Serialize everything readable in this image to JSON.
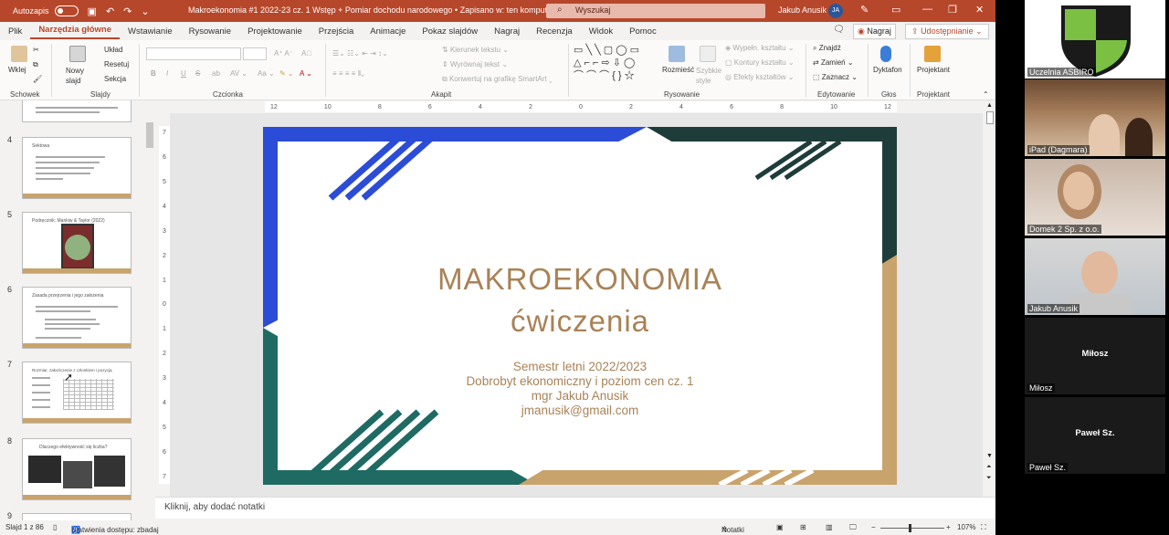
{
  "titlebar": {
    "autosave_label": "Autozapis",
    "doc_title": "Makroekonomia #1 2022-23 cz. 1 Wstęp + Pomiar dochodu narodowego • Zapisano w: ten komputer ⌄",
    "search_placeholder": "Wyszukaj",
    "user_name": "Jakub Anusik",
    "user_initials": "JA"
  },
  "tabs": [
    "Plik",
    "Narzędzia główne",
    "Wstawianie",
    "Rysowanie",
    "Projektowanie",
    "Przejścia",
    "Animacje",
    "Pokaz slajdów",
    "Nagraj",
    "Recenzja",
    "Widok",
    "Pomoc"
  ],
  "tab_actions": {
    "record": "Nagraj",
    "share": "Udostępnianie"
  },
  "ribbon": {
    "clipboard": {
      "paste": "Wklej",
      "group": "Schowek"
    },
    "slides": {
      "new_slide": "Nowy slajd",
      "layout": "Układ",
      "reset": "Resetuj",
      "section": "Sekcja",
      "group": "Slajdy"
    },
    "font": {
      "group": "Czcionka",
      "bold": "B",
      "italic": "I",
      "underline": "U",
      "strike": "S"
    },
    "paragraph": {
      "text_direction": "Kierunek tekstu",
      "align_text": "Wyrównaj tekst",
      "smartart": "Konwertuj na grafikę SmartArt",
      "group": "Akapit"
    },
    "drawing": {
      "arrange": "Rozmieść",
      "quick_styles": "Szybkie style",
      "fill": "Wypełn. kształtu",
      "outline": "Kontury kształtu",
      "effects": "Efekty kształtów",
      "group": "Rysowanie"
    },
    "editing": {
      "find": "Znajdź",
      "replace": "Zamień",
      "select": "Zaznacz",
      "group": "Edytowanie"
    },
    "voice": {
      "dictate": "Dyktafon",
      "group": "Głos"
    },
    "designer": {
      "label": "Projektant",
      "group": "Projektant"
    }
  },
  "thumbnails": [
    {
      "num": "4",
      "title": "Sektowa"
    },
    {
      "num": "5",
      "title": "Podręcznik: Mankiw & Taylor (2022)"
    },
    {
      "num": "6",
      "title": "Zasada przejrzenia i jego założenia"
    },
    {
      "num": "7",
      "title": "Rozmiar, zakończenie z członkiem i pozycją"
    },
    {
      "num": "8",
      "title": "Dlaczego efektywność się liczba?"
    },
    {
      "num": "9",
      "title": ""
    }
  ],
  "ruler_h": [
    "12",
    "10",
    "8",
    "6",
    "4",
    "2",
    "0",
    "2",
    "4",
    "6",
    "8",
    "10",
    "12"
  ],
  "ruler_v": [
    "7",
    "6",
    "5",
    "4",
    "3",
    "2",
    "1",
    "0",
    "1",
    "2",
    "3",
    "4",
    "5",
    "6",
    "7"
  ],
  "slide": {
    "title1": "MAKROEKONOMIA",
    "title2": "ćwiczenia",
    "line1": "Semestr letni 2022/2023",
    "line2": "Dobrobyt ekonomiczny i poziom cen cz. 1",
    "line3": "mgr Jakub Anusik",
    "line4": "jmanusik@gmail.com"
  },
  "notes_placeholder": "Kliknij, aby dodać notatki",
  "status": {
    "slide_info": "Slajd 1 z 86",
    "accessibility": "Ułatwienia dostępu: zbadaj",
    "notes_btn": "Notatki",
    "zoom": "107%"
  },
  "participants": [
    {
      "name": "Uczelnia ASBIRO",
      "kind": "logo"
    },
    {
      "name": "iPad (Dagmara)",
      "kind": "video"
    },
    {
      "name": "Domek 2 Sp. z o.o.",
      "kind": "video"
    },
    {
      "name": "Jakub Anusik",
      "kind": "video"
    },
    {
      "name": "Miłosz",
      "kind": "text",
      "center": "Miłosz"
    },
    {
      "name": "Paweł Sz.",
      "kind": "text",
      "center": "Paweł Sz."
    }
  ],
  "colors": {
    "accent": "#b7472a",
    "slide_gold": "#c9a36c",
    "slide_blue": "#2b4cd6",
    "slide_teal": "#1f6b63",
    "slide_dark": "#1e3c3a"
  }
}
